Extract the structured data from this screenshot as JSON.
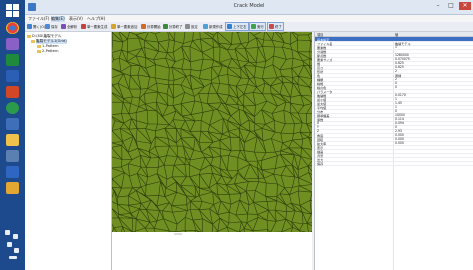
{
  "window": {
    "title": "Crack Model"
  },
  "menubar": {
    "items": [
      "ファイル(F)",
      "編集(E)",
      "表示(V)",
      "ヘルプ(H)"
    ]
  },
  "toolbar": {
    "items": [
      "開く(O)",
      "保存",
      "全解析",
      "単一要素生成",
      "単一要素追加",
      "計算開始",
      "計算終了",
      "設定",
      "新規作成",
      "上下左右",
      "実行",
      "終了"
    ]
  },
  "tree": {
    "nodes": [
      {
        "label": "D:\\3D\\亀裂モデル"
      },
      {
        "label": "亀裂モデル1(Grid)"
      },
      {
        "label": "1-Pattern"
      },
      {
        "label": "2-Pattern"
      }
    ]
  },
  "props": {
    "header_name": "項目",
    "header_value": "値",
    "rows": [
      {
        "name": "基本設定",
        "value": ""
      },
      {
        "name": "ファイル名",
        "value": "亀裂モデル"
      },
      {
        "name": "要素数",
        "value": "1"
      },
      {
        "name": "分割数",
        "value": ""
      },
      {
        "name": "節点数",
        "value": "1280000"
      },
      {
        "name": "要素サイズ",
        "value": "0.070075"
      },
      {
        "name": "幅",
        "value": "0.625"
      },
      {
        "name": "高さ",
        "value": "0.625"
      },
      {
        "name": "形状",
        "value": "2"
      },
      {
        "name": "色",
        "value": "黄緑"
      },
      {
        "name": "種類",
        "value": "2"
      },
      {
        "name": "線幅",
        "value": "0"
      },
      {
        "name": "線の色",
        "value": "0"
      },
      {
        "name": "パラメータ",
        "value": ""
      },
      {
        "name": "亀裂幅",
        "value": "0.0170"
      },
      {
        "name": "最小値",
        "value": "1"
      },
      {
        "name": "最大値",
        "value": "1.45"
      },
      {
        "name": "平均値",
        "value": "1"
      },
      {
        "name": "分布",
        "value": "0"
      },
      {
        "name": "標準偏差",
        "value": "10000"
      },
      {
        "name": "係数",
        "value": "0.114"
      },
      {
        "name": "X",
        "value": "0.094"
      },
      {
        "name": "Y",
        "value": "0"
      },
      {
        "name": "Z",
        "value": "2.93"
      },
      {
        "name": "角度",
        "value": "0.000"
      },
      {
        "name": "回転",
        "value": "0.000"
      },
      {
        "name": "拡大率",
        "value": "0.000"
      },
      {
        "name": "表示",
        "value": ""
      },
      {
        "name": "描画",
        "value": ""
      },
      {
        "name": "背景",
        "value": ""
      },
      {
        "name": "出力",
        "value": ""
      },
      {
        "name": "保存",
        "value": ""
      }
    ]
  },
  "crack_field": {
    "fill_color": "#6f8f22",
    "line_color": "#2e3d0c"
  }
}
